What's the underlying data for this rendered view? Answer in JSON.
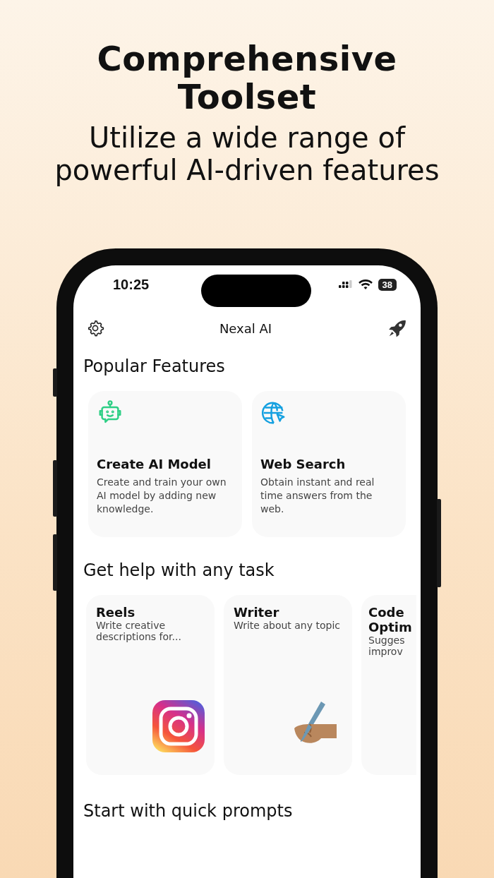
{
  "hero": {
    "title": "Comprehensive Toolset",
    "subtitle": "Utilize a wide range of powerful AI-driven features"
  },
  "status_bar": {
    "time": "10:25",
    "battery": "38"
  },
  "nav": {
    "title": "Nexal AI"
  },
  "popular_features": {
    "title": "Popular Features",
    "cards": [
      {
        "kind": "robot",
        "title": "Create AI Model",
        "description": "Create and train your own AI model by adding new knowledge."
      },
      {
        "kind": "globe",
        "title": "Web Search",
        "description": "Obtain instant and real time answers from the web."
      }
    ]
  },
  "task_help": {
    "title": "Get help with any task",
    "cards": [
      {
        "kind": "camera",
        "title": "Reels",
        "description": "Write creative descriptions for..."
      },
      {
        "kind": "writing",
        "title": "Writer",
        "description": "Write about any topic"
      },
      {
        "kind": "none",
        "title": "Code Optim",
        "description": "Sugges improv"
      }
    ]
  },
  "quick_prompts": {
    "title": "Start with quick prompts"
  }
}
